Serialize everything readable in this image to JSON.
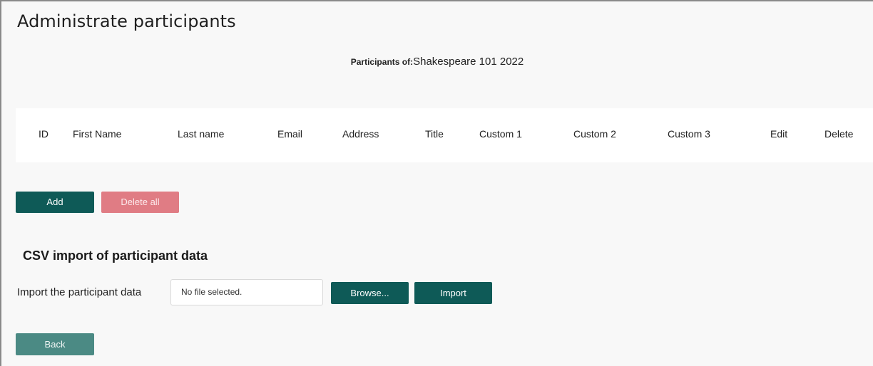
{
  "page": {
    "title": "Administrate participants",
    "participants_label": "Participants of:",
    "participants_value": "Shakespeare 101 2022"
  },
  "table": {
    "columns": [
      "ID",
      "First Name",
      "Last name",
      "Email",
      "Address",
      "Title",
      "Custom 1",
      "Custom 2",
      "Custom 3",
      "Edit",
      "Delete"
    ],
    "rows": []
  },
  "actions": {
    "add_label": "Add",
    "delete_all_label": "Delete all"
  },
  "csv_import": {
    "section_title": "CSV import of participant data",
    "field_label": "Import the participant data",
    "file_status": "No file selected.",
    "browse_label": "Browse...",
    "import_label": "Import"
  },
  "footer": {
    "back_label": "Back"
  },
  "colors": {
    "primary": "#0e5a57",
    "danger": "#e07c84",
    "back": "#4b8a84",
    "background": "#f8f8f8"
  }
}
